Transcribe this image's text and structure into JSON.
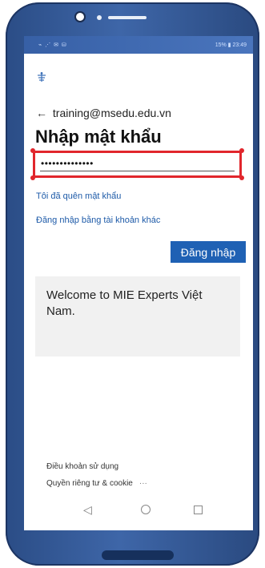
{
  "status": {
    "left": "⌁ ⋰ ✉ ⛁",
    "right": "15% ▮ 23:49"
  },
  "account": {
    "email": "training@msedu.edu.vn",
    "back_arrow": "←"
  },
  "title": "Nhập mật khẩu",
  "password": {
    "masked_value": "••••••••••••••"
  },
  "links": {
    "forgot": "Tôi đã quên mật khẩu",
    "other_account": "Đăng nhập bằng tài khoản khác"
  },
  "signin_button": "Đăng nhập",
  "welcome_text": "Welcome to MIE Experts Việt Nam.",
  "footer": {
    "terms": "Điều khoản sử dụng",
    "privacy": "Quyền riêng tư & cookie",
    "more": "···"
  },
  "nav": {
    "back": "◁"
  },
  "colors": {
    "accent": "#1f61b4",
    "highlight": "#e1262c",
    "phone_frame": "#2b4d86"
  },
  "icons": {
    "logo": "tenant-logo-icon",
    "back": "back-arrow-icon",
    "home": "home-nav-icon",
    "recent": "recent-apps-icon"
  }
}
